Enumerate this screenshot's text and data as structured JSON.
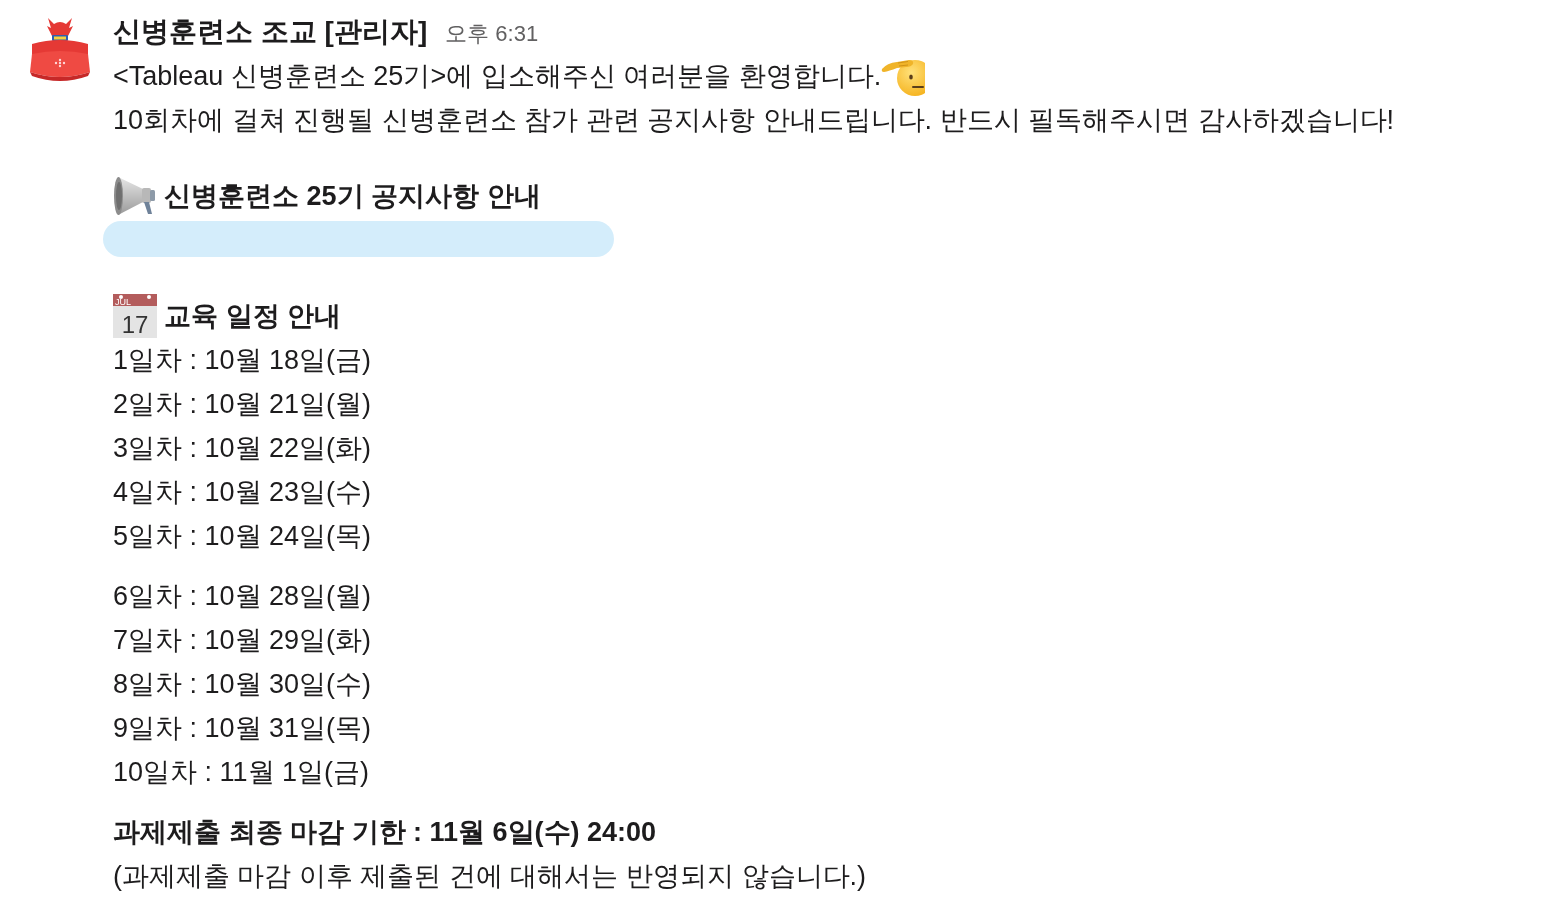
{
  "message": {
    "author": "신병훈련소 조교 [관리자]",
    "time": "오후 6:31",
    "welcome": "<Tableau 신병훈련소 25기>에 입소해주신 여러분을 환영합니다.",
    "instructions": "10회차에 걸쳐 진행될 신병훈련소 참가 관련 공지사항 안내드립니다. 반드시 필독해주시면 감사하겠습니다!",
    "notice_heading": "신병훈련소 25기 공지사항 안내",
    "schedule_heading": {
      "calendar_month": "JUL",
      "calendar_day": "17",
      "text": "교육 일정 안내"
    },
    "schedule_groups": [
      {
        "entries": [
          "1일차 : 10월 18일(금)",
          "2일차 : 10월 21일(월)",
          "3일차 : 10월 22일(화)",
          "4일차 : 10월 23일(수)",
          "5일차 : 10월 24일(목)"
        ]
      },
      {
        "entries": [
          "6일차 : 10월 28일(월)",
          "7일차 : 10월 29일(화)",
          "8일차 : 10월 30일(수)",
          "9일차 : 10월 31일(목)",
          "10일차 : 11월 1일(금)"
        ]
      }
    ],
    "deadline": "과제제출 최종 마감 기한 : 11월 6일(수) 24:00",
    "deadline_note": "(과제제출 마감 이후 제출된 건에 대해서는 반영되지 않습니다.)"
  }
}
